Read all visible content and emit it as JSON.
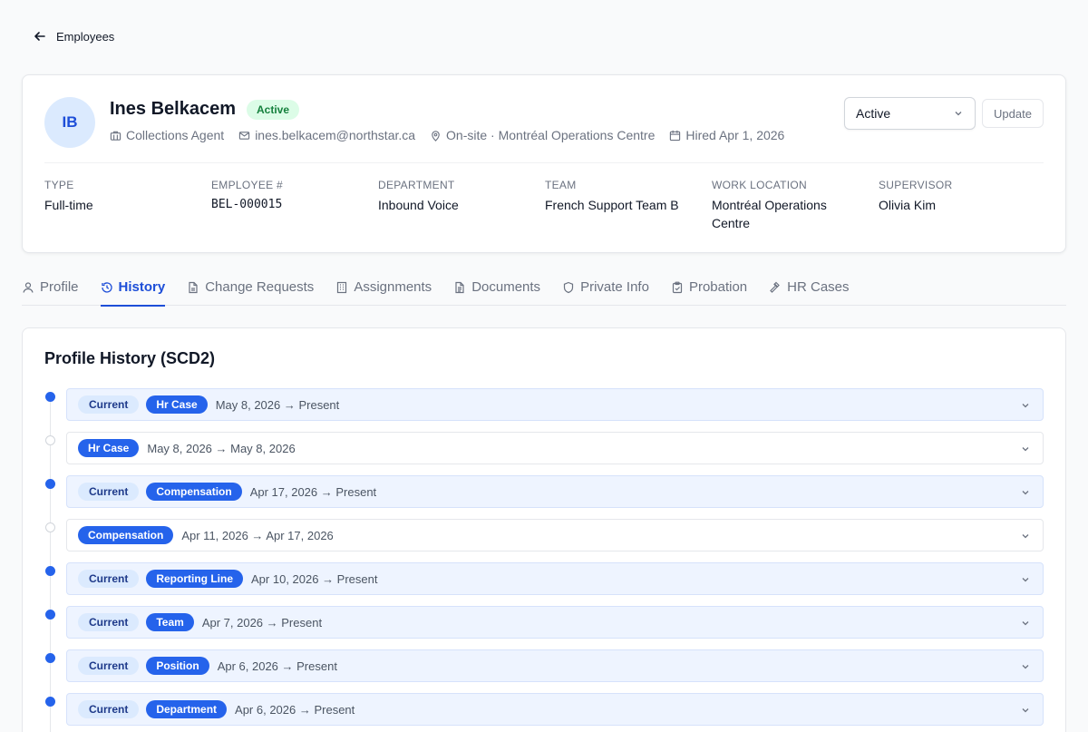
{
  "nav": {
    "back_label": "Employees"
  },
  "employee": {
    "initials": "IB",
    "name": "Ines Belkacem",
    "status_badge": "Active",
    "title": "Collections Agent",
    "email": "ines.belkacem@northstar.ca",
    "location_summary": "On-site · Montréal Operations Centre",
    "hired": "Hired Apr 1, 2026"
  },
  "actions": {
    "status_value": "Active",
    "update_label": "Update"
  },
  "fields": [
    {
      "label": "Type",
      "value": "Full-time"
    },
    {
      "label": "Employee #",
      "value": "BEL-000015"
    },
    {
      "label": "Department",
      "value": "Inbound Voice"
    },
    {
      "label": "Team",
      "value": "French Support Team B"
    },
    {
      "label": "Work Location",
      "value": "Montréal Operations Centre"
    },
    {
      "label": "Supervisor",
      "value": "Olivia Kim"
    }
  ],
  "tabs": [
    {
      "label": "Profile",
      "icon": "user-icon"
    },
    {
      "label": "History",
      "icon": "history-icon"
    },
    {
      "label": "Change Requests",
      "icon": "file-icon"
    },
    {
      "label": "Assignments",
      "icon": "building-icon"
    },
    {
      "label": "Documents",
      "icon": "document-icon"
    },
    {
      "label": "Private Info",
      "icon": "shield-icon"
    },
    {
      "label": "Probation",
      "icon": "clipboard-icon"
    },
    {
      "label": "HR Cases",
      "icon": "gavel-icon"
    }
  ],
  "active_tab": "History",
  "history": {
    "title": "Profile History (SCD2)",
    "current_label": "Current",
    "entries": [
      {
        "current": true,
        "type": "Hr Case",
        "dates": "May 8, 2026 → Present"
      },
      {
        "current": false,
        "type": "Hr Case",
        "dates": "May 8, 2026 → May 8, 2026"
      },
      {
        "current": true,
        "type": "Compensation",
        "dates": "Apr 17, 2026 → Present"
      },
      {
        "current": false,
        "type": "Compensation",
        "dates": "Apr 11, 2026 → Apr 17, 2026"
      },
      {
        "current": true,
        "type": "Reporting Line",
        "dates": "Apr 10, 2026 → Present"
      },
      {
        "current": true,
        "type": "Team",
        "dates": "Apr 7, 2026 → Present"
      },
      {
        "current": true,
        "type": "Position",
        "dates": "Apr 6, 2026 → Present"
      },
      {
        "current": true,
        "type": "Department",
        "dates": "Apr 6, 2026 → Present"
      }
    ]
  },
  "colors": {
    "accent": "#2563eb",
    "active_badge_bg": "#dcfce7",
    "active_badge_text": "#15803d"
  }
}
